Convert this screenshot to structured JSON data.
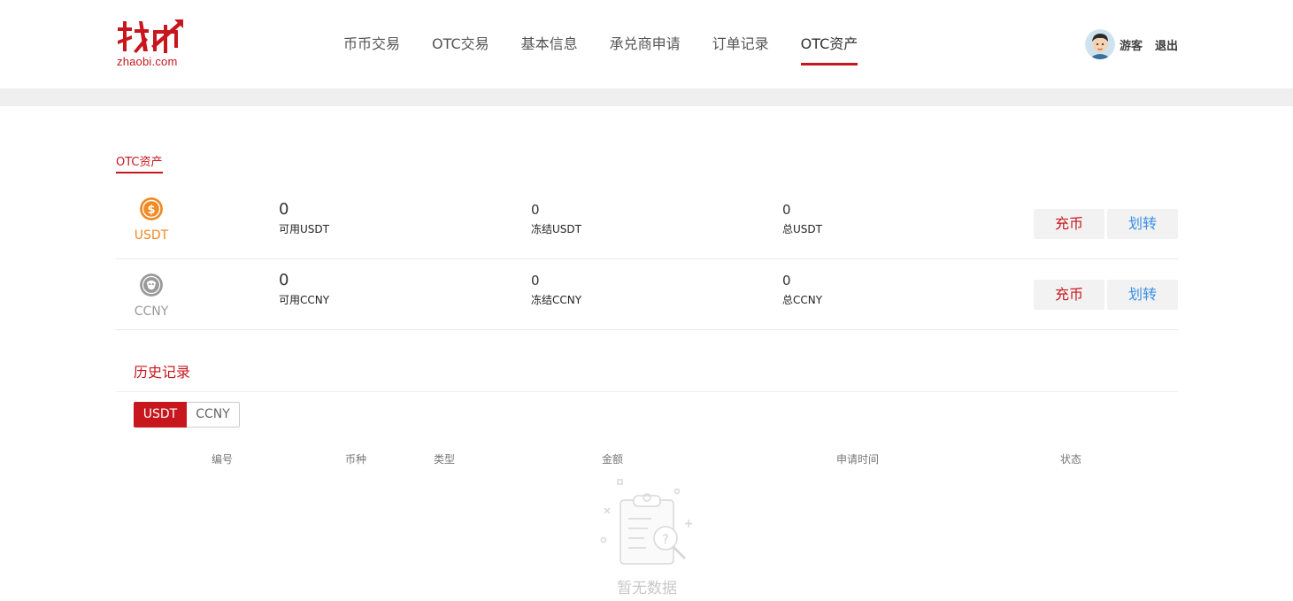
{
  "brand": {
    "logo_text": "zhaobi.com",
    "logo_mark": "找币",
    "accent": "#c8161d"
  },
  "nav": {
    "items": [
      {
        "label": "币币交易"
      },
      {
        "label": "OTC交易"
      },
      {
        "label": "基本信息"
      },
      {
        "label": "承兑商申请"
      },
      {
        "label": "订单记录"
      },
      {
        "label": "OTC资产",
        "active": true
      }
    ]
  },
  "user": {
    "name": "游客",
    "logout": "退出",
    "avatar_icon": "user-avatar-icon"
  },
  "section": {
    "title": "OTC资产"
  },
  "assets": [
    {
      "coin": "USDT",
      "icon": "dollar-coin-icon",
      "color": "#f08a24",
      "available": "0",
      "available_label": "可用USDT",
      "frozen": "0",
      "frozen_label": "冻结USDT",
      "total": "0",
      "total_label": "总USDT",
      "deposit": "充币",
      "transfer": "划转"
    },
    {
      "coin": "CCNY",
      "icon": "ccny-coin-icon",
      "color": "#999999",
      "available": "0",
      "available_label": "可用CCNY",
      "frozen": "0",
      "frozen_label": "冻结CCNY",
      "total": "0",
      "total_label": "总CCNY",
      "deposit": "充币",
      "transfer": "划转"
    }
  ],
  "history": {
    "title": "历史记录",
    "tabs": [
      {
        "label": "USDT",
        "active": true
      },
      {
        "label": "CCNY"
      }
    ],
    "columns": [
      "编号",
      "币种",
      "类型",
      "金额",
      "申请时间",
      "状态"
    ],
    "empty_text": "暂无数据",
    "empty_icon": "empty-clipboard-icon"
  }
}
